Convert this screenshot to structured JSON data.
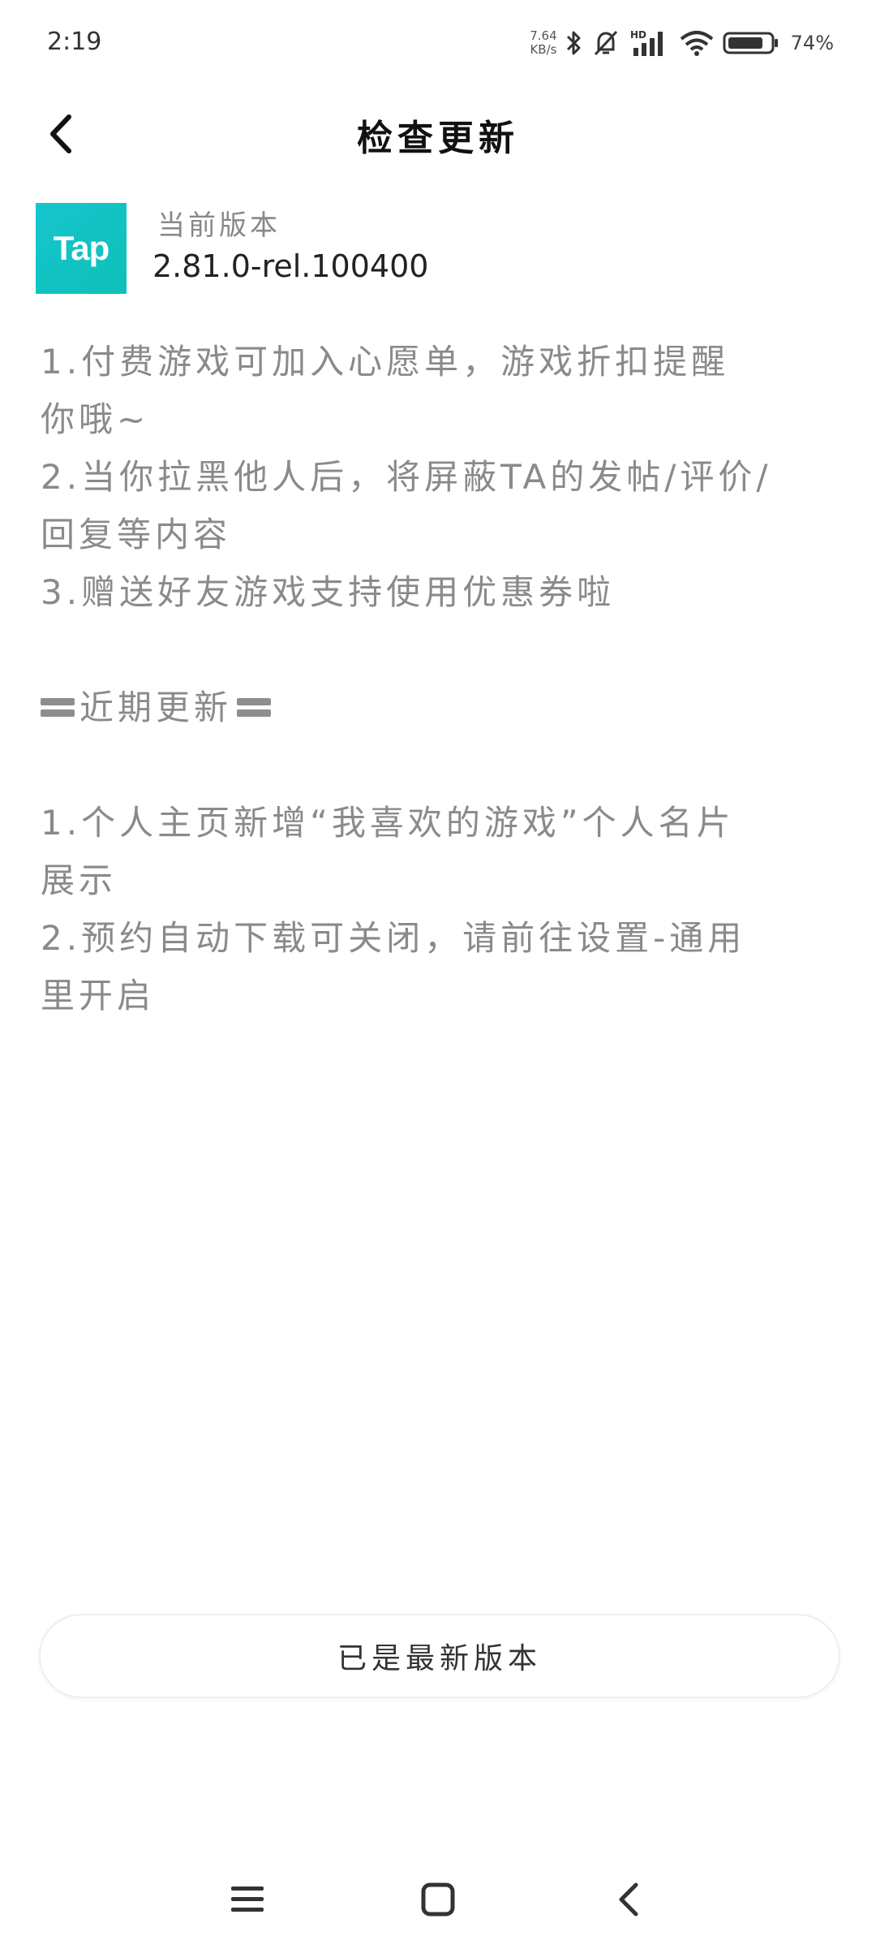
{
  "status_bar": {
    "time": "2:19",
    "net_speed_value": "7.64",
    "net_speed_unit": "KB/s",
    "signal_label": "HD",
    "battery": "74%"
  },
  "header": {
    "title": "检查更新"
  },
  "version": {
    "logo_text": "Tap",
    "label": "当前版本",
    "value": "2.81.0-rel.100400"
  },
  "notes": {
    "current": [
      "1.付费游戏可加入心愿单，游戏折扣提醒",
      "你哦~",
      "2.当你拉黑他人后，将屏蔽TA的发帖/评价/",
      "回复等内容",
      "3.赠送好友游戏支持使用优惠券啦"
    ],
    "recent_heading": "近期更新",
    "recent": [
      "1.个人主页新增“我喜欢的游戏”个人名片",
      "展示",
      "2.预约自动下载可关闭，请前往设置-通用",
      "里开启"
    ]
  },
  "footer": {
    "button_label": "已是最新版本"
  },
  "colors": {
    "accent": "#15c5ce",
    "note_text": "#8a8a8a"
  }
}
